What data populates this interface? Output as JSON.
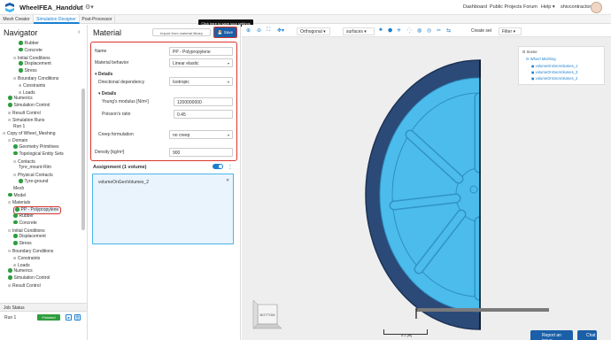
{
  "topbar": {
    "project_title": "WheelFEA_Handout",
    "nav": [
      "Dashboard",
      "Public Projects",
      "Forum",
      "Help ▾",
      "shivcontractor"
    ]
  },
  "tabs": [
    "Mesh Creator",
    "Simulation Designer",
    "Post-Processor"
  ],
  "tooltip": "Click here to save your settings",
  "navigator": {
    "title": "Navigator",
    "tree": [
      {
        "label": "Rubber",
        "depth": 3,
        "dot": true
      },
      {
        "label": "Concrete",
        "depth": 3,
        "dot": true
      },
      {
        "label": "Initial Conditions",
        "depth": 2,
        "toggle": "⊟"
      },
      {
        "label": "Displacement",
        "depth": 3,
        "dot": true
      },
      {
        "label": "Stress",
        "depth": 3,
        "dot": true
      },
      {
        "label": "Boundary Conditions",
        "depth": 2,
        "toggle": "⊟"
      },
      {
        "label": "Constraints",
        "depth": 3,
        "toggle": "⊞"
      },
      {
        "label": "Loads",
        "depth": 3,
        "toggle": "⊞"
      },
      {
        "label": "Numerics",
        "depth": 1,
        "dot": true
      },
      {
        "label": "Simulation Control",
        "depth": 1,
        "dot": true
      },
      {
        "label": "Result Control",
        "depth": 1,
        "toggle": "⊞"
      },
      {
        "label": "Simulation Runs",
        "depth": 1,
        "toggle": "⊟"
      },
      {
        "label": "Run 1",
        "depth": 2
      },
      {
        "label": "Copy of Wheel_Meshing",
        "depth": 0,
        "toggle": "⊟"
      },
      {
        "label": "Domain",
        "depth": 1,
        "toggle": "⊟"
      },
      {
        "label": "Geometry Primitives",
        "depth": 2,
        "dot": true
      },
      {
        "label": "Topological Entity Sets",
        "depth": 2,
        "dot": true
      },
      {
        "label": "Contacts",
        "depth": 2,
        "toggle": "⊟"
      },
      {
        "label": "Tyre_mount-Rim",
        "depth": 3
      },
      {
        "label": "Physical Contacts",
        "depth": 2,
        "toggle": "⊟"
      },
      {
        "label": "Tyre-ground",
        "depth": 3,
        "dot": true
      },
      {
        "label": "Mesh",
        "depth": 2
      },
      {
        "label": "Model",
        "depth": 1,
        "dot": true
      },
      {
        "label": "Materials",
        "depth": 1,
        "toggle": "⊟"
      },
      {
        "label": "PP - Polypropylene",
        "depth": 2,
        "dot": true,
        "selected": true
      },
      {
        "label": "Rubber",
        "depth": 2,
        "dot": true
      },
      {
        "label": "Concrete",
        "depth": 2,
        "dot": true
      },
      {
        "label": "Initial Conditions",
        "depth": 1,
        "toggle": "⊟"
      },
      {
        "label": "Displacement",
        "depth": 2,
        "dot": true
      },
      {
        "label": "Stress",
        "depth": 2,
        "dot": true
      },
      {
        "label": "Boundary Conditions",
        "depth": 1,
        "toggle": "⊟"
      },
      {
        "label": "Constraints",
        "depth": 2,
        "toggle": "⊞"
      },
      {
        "label": "Loads",
        "depth": 2,
        "toggle": "⊞"
      },
      {
        "label": "Numerics",
        "depth": 1,
        "dot": true
      },
      {
        "label": "Simulation Control",
        "depth": 1,
        "dot": true
      },
      {
        "label": "Result Control",
        "depth": 1,
        "toggle": "⊞"
      }
    ]
  },
  "job_status": {
    "title": "Job Status",
    "run_name": "Run 1",
    "status": "Finished"
  },
  "material": {
    "title": "Material",
    "import_label": "Import from material library",
    "save_label": "Save",
    "name_label": "Name",
    "name_value": "PP - Polypropylene",
    "behavior_label": "Material behavior",
    "behavior_value": "Linear elastic",
    "details_label": "Details",
    "direction_label": "Directional dependency",
    "direction_value": "Isotropic",
    "details2_label": "Details",
    "youngs_label": "Young's modulus [N/m²]",
    "youngs_value": "1200000000",
    "poisson_label": "Poisson's ratio",
    "poisson_value": "0.45",
    "creep_label": "Creep formulation",
    "creep_value": "no creep",
    "density_label": "Density [kg/m³]",
    "density_value": "900",
    "assignment_label": "Assignment (1 volume)",
    "assigned_item": "volumeOnGeoVolumes_2"
  },
  "viewer": {
    "projection": "Orthogonal",
    "render_mode": "surfaces",
    "create_set": "Create set",
    "filter": "Filter",
    "scene_tree": [
      "Scene",
      "Wheel Meshing",
      "volumeOnGeoVolumes_1",
      "volumeOnGeoVolumes_3",
      "volumeOnGeoVolumes_2"
    ],
    "cube_face": "BOTTOM",
    "scale_label": "0.1 [m]",
    "tyre_color": "#2b4a78",
    "rim_color": "#4bbcec"
  },
  "footer": {
    "report_label": "Report an issue",
    "chat_label": "Chat"
  }
}
